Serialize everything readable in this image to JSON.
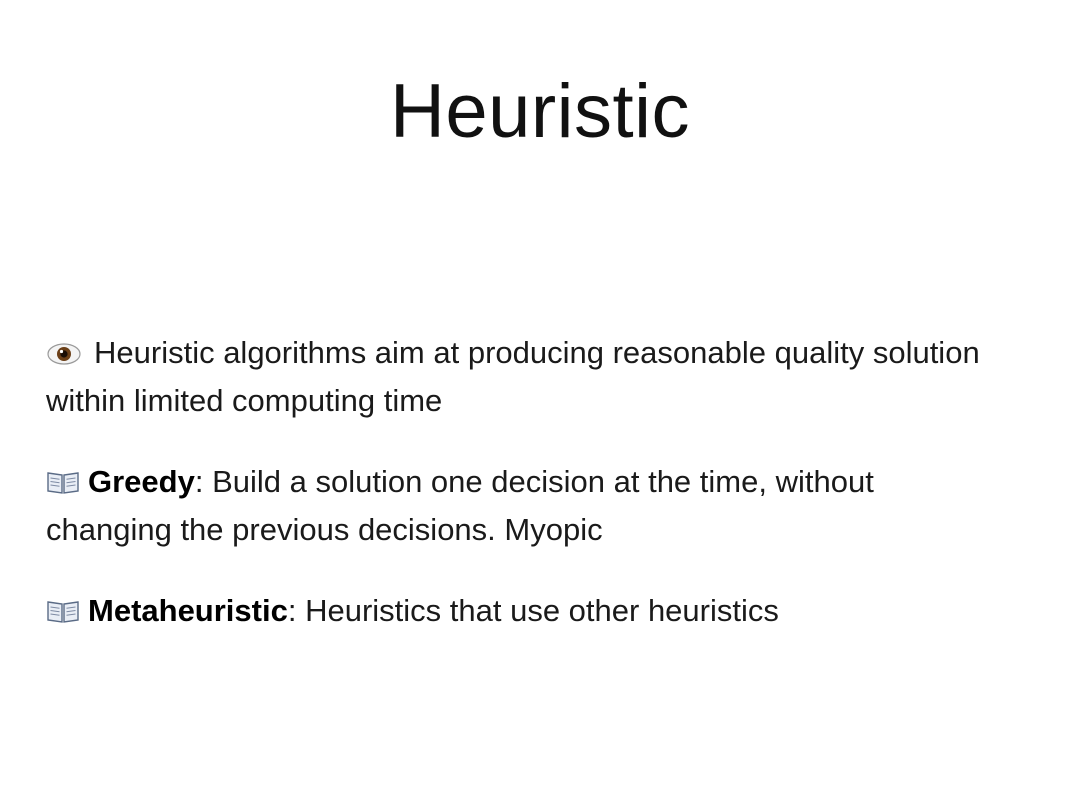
{
  "slide": {
    "title": "Heuristic",
    "bullets": [
      {
        "icon": "eye-icon",
        "term": "",
        "text": "Heuristic algorithms aim at producing reasonable quality solution within limited computing time"
      },
      {
        "icon": "book-icon",
        "term": "Greedy",
        "text": ": Build a solution one decision at the time, without changing the previous decisions. Myopic"
      },
      {
        "icon": "book-icon",
        "term": "Metaheuristic",
        "text": ": Heuristics that use other heuristics"
      }
    ]
  },
  "colors": {
    "background": "#ffffff",
    "text": "#111111",
    "eye_iris": "#6b3f17"
  }
}
